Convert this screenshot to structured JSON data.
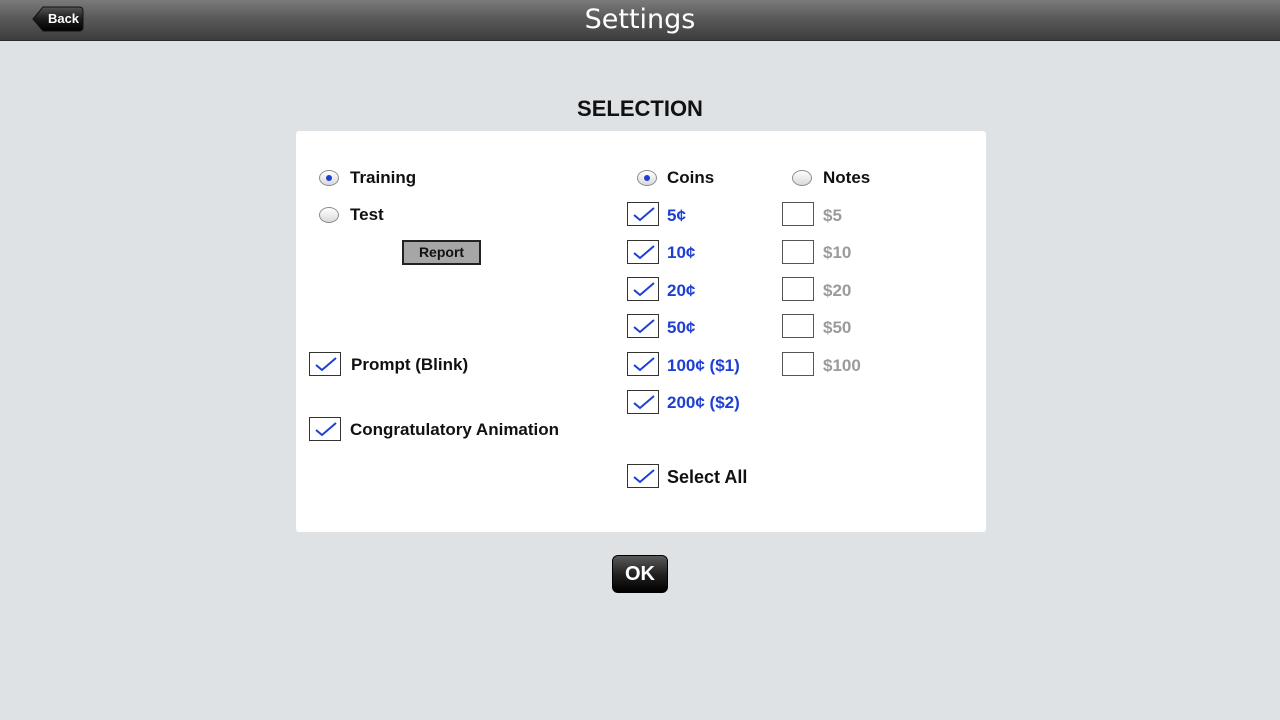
{
  "header": {
    "title": "Settings",
    "back_label": "Back"
  },
  "section_title": "SELECTION",
  "mode": {
    "training_label": "Training",
    "test_label": "Test",
    "selected": "Training",
    "report_label": "Report"
  },
  "options": {
    "prompt_label": "Prompt (Blink)",
    "prompt_checked": true,
    "animation_label": "Congratulatory Animation",
    "animation_checked": true
  },
  "coins": {
    "label": "Coins",
    "selected": true,
    "items": [
      {
        "label": "5¢",
        "checked": true
      },
      {
        "label": "10¢",
        "checked": true
      },
      {
        "label": "20¢",
        "checked": true
      },
      {
        "label": "50¢",
        "checked": true
      },
      {
        "label": "100¢ ($1)",
        "checked": true
      },
      {
        "label": "200¢ ($2)",
        "checked": true
      }
    ]
  },
  "notes": {
    "label": "Notes",
    "selected": false,
    "items": [
      {
        "label": "$5",
        "checked": false
      },
      {
        "label": "$10",
        "checked": false
      },
      {
        "label": "$20",
        "checked": false
      },
      {
        "label": "$50",
        "checked": false
      },
      {
        "label": "$100",
        "checked": false
      }
    ]
  },
  "select_all": {
    "label": "Select All",
    "checked": true
  },
  "ok_label": "OK",
  "colors": {
    "accent_blue": "#1f3fd4",
    "disabled_grey": "#9b9b9b",
    "background": "#dfe2e4"
  }
}
